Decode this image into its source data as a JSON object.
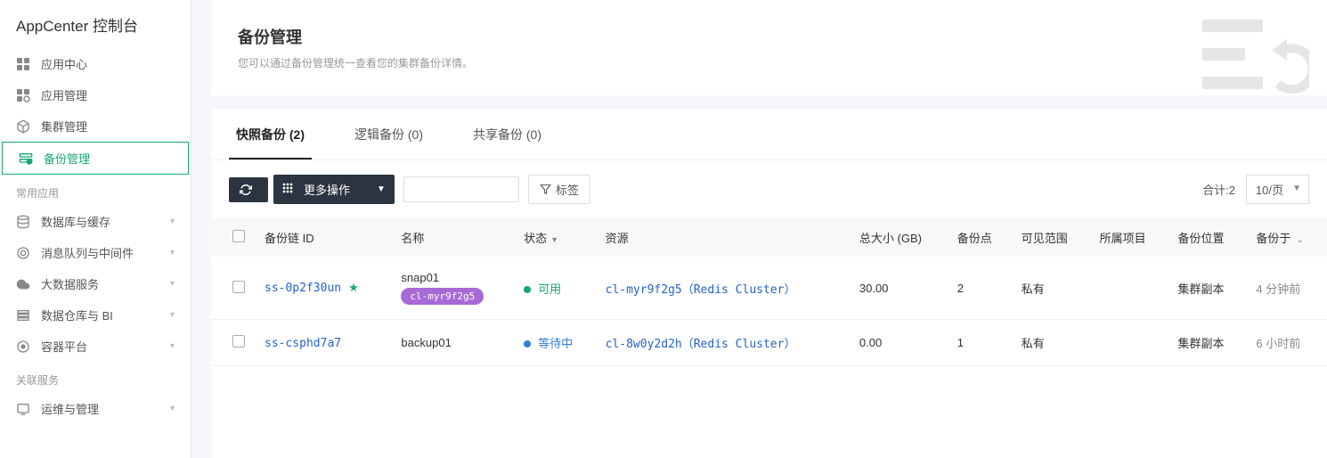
{
  "sidebar": {
    "title": "AppCenter 控制台",
    "nav": [
      {
        "label": "应用中心",
        "icon": "grid"
      },
      {
        "label": "应用管理",
        "icon": "grid-gear"
      },
      {
        "label": "集群管理",
        "icon": "cube"
      },
      {
        "label": "备份管理",
        "icon": "backup",
        "active": true
      }
    ],
    "sections": [
      {
        "title": "常用应用",
        "items": [
          {
            "label": "数据库与缓存",
            "icon": "db"
          },
          {
            "label": "消息队列与中间件",
            "icon": "mq"
          },
          {
            "label": "大数据服务",
            "icon": "bigdata"
          },
          {
            "label": "数据仓库与 BI",
            "icon": "warehouse"
          },
          {
            "label": "容器平台",
            "icon": "container"
          }
        ]
      },
      {
        "title": "关联服务",
        "items": [
          {
            "label": "运维与管理",
            "icon": "ops"
          }
        ]
      }
    ]
  },
  "header": {
    "title": "备份管理",
    "desc": "您可以通过备份管理统一查看您的集群备份详情。"
  },
  "tabs": [
    {
      "label": "快照备份 (2)",
      "active": true
    },
    {
      "label": "逻辑备份 (0)"
    },
    {
      "label": "共享备份 (0)"
    }
  ],
  "toolbar": {
    "more_label": "更多操作",
    "tag_label": "标签",
    "total_label": "合计:2",
    "page_size": "10/页"
  },
  "table": {
    "columns": {
      "id": "备份链 ID",
      "name": "名称",
      "status": "状态",
      "resource": "资源",
      "size": "总大小 (GB)",
      "points": "备份点",
      "visibility": "可见范围",
      "project": "所属项目",
      "location": "备份位置",
      "time": "备份于"
    },
    "rows": [
      {
        "id": "ss-0p2f30un",
        "starred": true,
        "name": "snap01",
        "name_badge": "cl-myr9f2g5",
        "status_text": "可用",
        "status_color": "green",
        "resource": "cl-myr9f2g5（Redis Cluster）",
        "size": "30.00",
        "points": "2",
        "visibility": "私有",
        "project": "",
        "location": "集群副本",
        "time": "4 分钟前"
      },
      {
        "id": "ss-csphd7a7",
        "starred": false,
        "name": "backup01",
        "name_badge": "",
        "status_text": "等待中",
        "status_color": "blue",
        "resource": "cl-8w0y2d2h（Redis Cluster）",
        "size": "0.00",
        "points": "1",
        "visibility": "私有",
        "project": "",
        "location": "集群副本",
        "time": "6 小时前"
      }
    ]
  }
}
